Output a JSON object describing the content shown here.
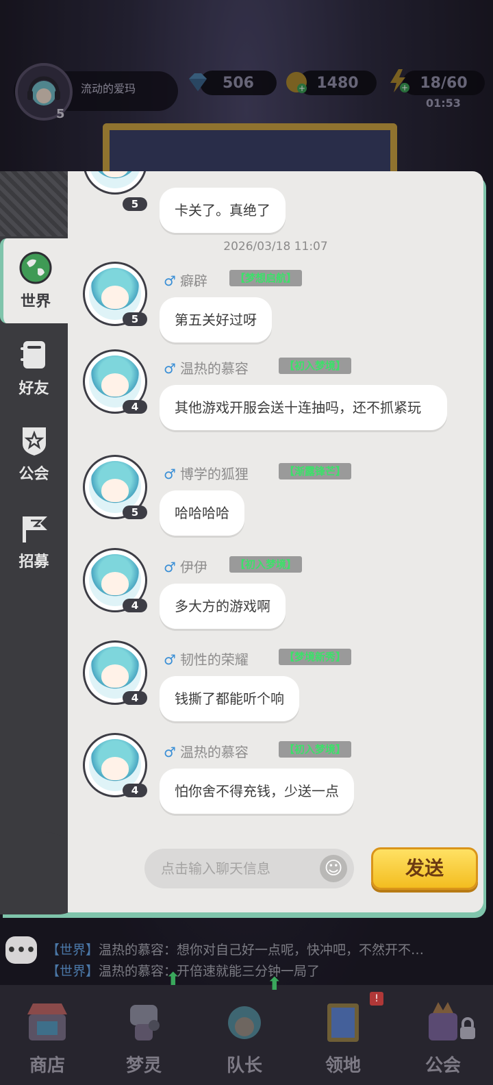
{
  "header": {
    "player_name": "流动的爱玛",
    "player_level": "5",
    "diamonds": "506",
    "coins": "1480",
    "energy": "18/60",
    "energy_timer": "01:53"
  },
  "sidebar": {
    "tabs": [
      {
        "label": "世界",
        "icon": "globe-icon",
        "active": true
      },
      {
        "label": "好友",
        "icon": "friends-book-icon",
        "active": false
      },
      {
        "label": "公会",
        "icon": "guild-shield-icon",
        "active": false
      },
      {
        "label": "招募",
        "icon": "flag-icon",
        "active": false
      }
    ]
  },
  "chat": {
    "timestamp": "2026/03/18  11:07",
    "gender_symbol": "♂",
    "top_partial": {
      "level": "5",
      "text": "卡关了。真绝了"
    },
    "messages": [
      {
        "level": "5",
        "name": "癖辟",
        "title": "【梦想启航】",
        "text": "第五关好过呀"
      },
      {
        "level": "4",
        "name": "温热的慕容",
        "title": "【初入梦境】",
        "text": "其他游戏开服会送十连抽吗，还不抓紧玩"
      },
      {
        "level": "5",
        "name": "博学的狐狸",
        "title": "【渐露锋芒】",
        "text": "哈哈哈哈"
      },
      {
        "level": "4",
        "name": "伊伊",
        "title": "【初入梦境】",
        "text": "多大方的游戏啊"
      },
      {
        "level": "4",
        "name": "韧性的荣耀",
        "title": "【梦境新秀】",
        "text": "钱撕了都能听个响"
      },
      {
        "level": "4",
        "name": "温热的慕容",
        "title": "【初入梦境】",
        "text": "怕你舍不得充钱，少送一点"
      }
    ]
  },
  "input": {
    "placeholder": "点击输入聊天信息",
    "send_label": "发送"
  },
  "ticker": {
    "lines": [
      {
        "tag": "【世界】",
        "text": "温热的慕容：想你对自己好一点呢，快冲吧，不然开不…"
      },
      {
        "tag": "【世界】",
        "text": "温热的慕容：开倍速就能三分钟一局了"
      }
    ]
  },
  "bottom_nav": {
    "items": [
      {
        "label": "商店",
        "icon": "shop-icon"
      },
      {
        "label": "梦灵",
        "icon": "robot-icon"
      },
      {
        "label": "队长",
        "icon": "captain-icon"
      },
      {
        "label": "领地",
        "icon": "territory-icon"
      },
      {
        "label": "公会",
        "icon": "guild-icon"
      }
    ],
    "badge": "!"
  },
  "colors": {
    "panel_bg": "#ebeae8",
    "sidebar_bg": "#3b3b3f",
    "accent_teal": "#7fc4ab",
    "send_yellow": "#f3bd20",
    "title_green": "#3de06a",
    "male_blue": "#3a8fd6"
  }
}
